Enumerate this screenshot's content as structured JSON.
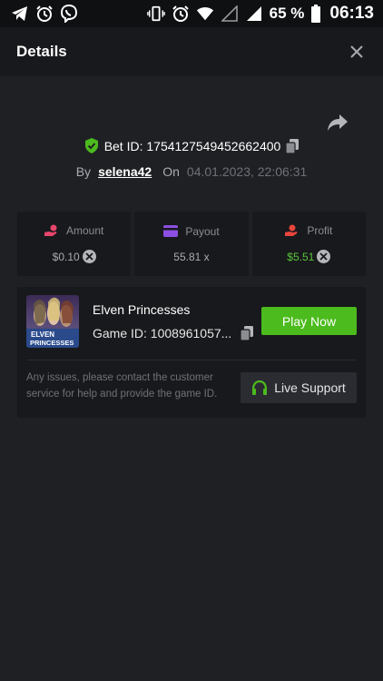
{
  "status_bar": {
    "battery_percent": "65 %",
    "time": "06:13",
    "left_icons": [
      "telegram-icon",
      "alarm-icon",
      "viber-icon"
    ],
    "right_icons": [
      "vibrate-icon",
      "alarm-icon",
      "wifi-icon",
      "signal-empty-icon",
      "signal-icon",
      "battery-icon"
    ]
  },
  "header": {
    "title": "Details",
    "close_icon": "close-icon"
  },
  "bet": {
    "label": "Bet ID: 1754127549452662400",
    "by_label": "By",
    "username": "selena42",
    "on_label": "On",
    "date": "04.01.2023, 22:06:31"
  },
  "stats": [
    {
      "label": "Amount",
      "value": "$0.10",
      "icon": "hand-coin-icon",
      "icon_color": "#e8456b",
      "badge": "x-circle-icon"
    },
    {
      "label": "Payout",
      "value": "55.81 x",
      "icon": "card-icon",
      "icon_color": "#8b4fe3"
    },
    {
      "label": "Profit",
      "value": "$5.51",
      "icon": "hand-profit-icon",
      "icon_color": "#e8453c",
      "value_color": "#58c538",
      "badge": "x-circle-icon"
    }
  ],
  "game": {
    "name": "Elven Princesses",
    "id_text": "Game ID: 1008961057...",
    "thumb_text_top": "ELVEN",
    "thumb_text_bottom": "PRINCESSES",
    "play_label": "Play Now",
    "support_text": "Any issues, please contact the customer service for help and provide the game ID.",
    "support_label": "Live Support"
  },
  "colors": {
    "accent_green": "#4cbb1d",
    "background": "#1f2024",
    "card": "#18191c"
  }
}
